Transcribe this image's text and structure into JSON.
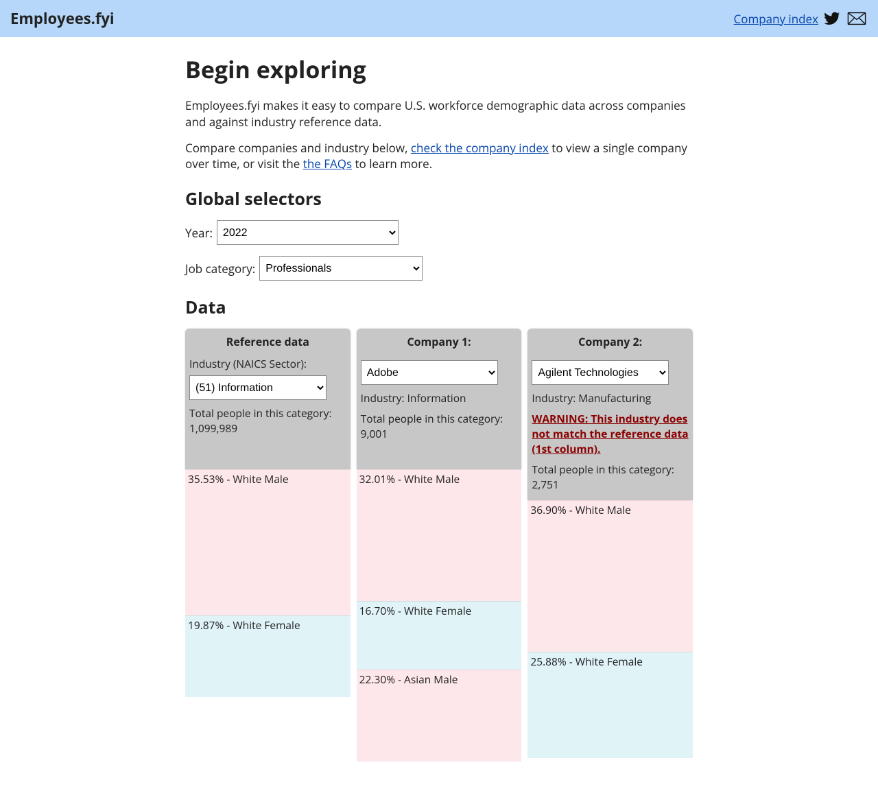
{
  "header": {
    "brand": "Employees.fyi",
    "company_index_label": "Company index"
  },
  "main": {
    "title": "Begin exploring",
    "intro": "Employees.fyi makes it easy to compare U.S. workforce demographic data across companies and against industry reference data.",
    "p2_a": "Compare companies and industry below, ",
    "p2_link1": "check the company index",
    "p2_b": " to view a single company over time, or visit the ",
    "p2_link2": "the FAQs",
    "p2_c": " to learn more."
  },
  "selectors": {
    "heading": "Global selectors",
    "year_label": "Year:",
    "year_value": "2022",
    "job_label": "Job category:",
    "job_value": "Professionals"
  },
  "data": {
    "heading": "Data",
    "ref": {
      "title": "Reference data",
      "industry_label": "Industry (NAICS Sector):",
      "industry_value": "(51) Information",
      "total_label": "Total people in this category: 1,099,989"
    },
    "c1": {
      "title": "Company 1:",
      "value": "Adobe",
      "industry": "Industry: Information",
      "total": "Total people in this category: 9,001"
    },
    "c2": {
      "title": "Company 2:",
      "value": "Agilent Technologies",
      "industry": "Industry: Manufacturing",
      "warning": "WARNING: This industry does not match the reference data (1st column).",
      "total": "Total people in this category: 2,751"
    }
  },
  "chart_data": {
    "type": "bar",
    "unit": "percent",
    "note": "Stacked demographic breakdown; only segments visible in viewport are listed. Bar pixel heights are scaled ~6px per 1%.",
    "columns": [
      {
        "name": "Reference data",
        "segments": [
          {
            "label": "White Male",
            "value": 35.53,
            "color": "pink"
          },
          {
            "label": "White Female",
            "value": 19.87,
            "color": "blue"
          }
        ]
      },
      {
        "name": "Company 1 (Adobe)",
        "segments": [
          {
            "label": "White Male",
            "value": 32.01,
            "color": "pink"
          },
          {
            "label": "White Female",
            "value": 16.7,
            "color": "blue"
          },
          {
            "label": "Asian Male",
            "value": 22.3,
            "color": "pink"
          }
        ]
      },
      {
        "name": "Company 2 (Agilent Technologies)",
        "segments": [
          {
            "label": "White Male",
            "value": 36.9,
            "color": "pink"
          },
          {
            "label": "White Female",
            "value": 25.88,
            "color": "blue"
          }
        ]
      }
    ]
  }
}
